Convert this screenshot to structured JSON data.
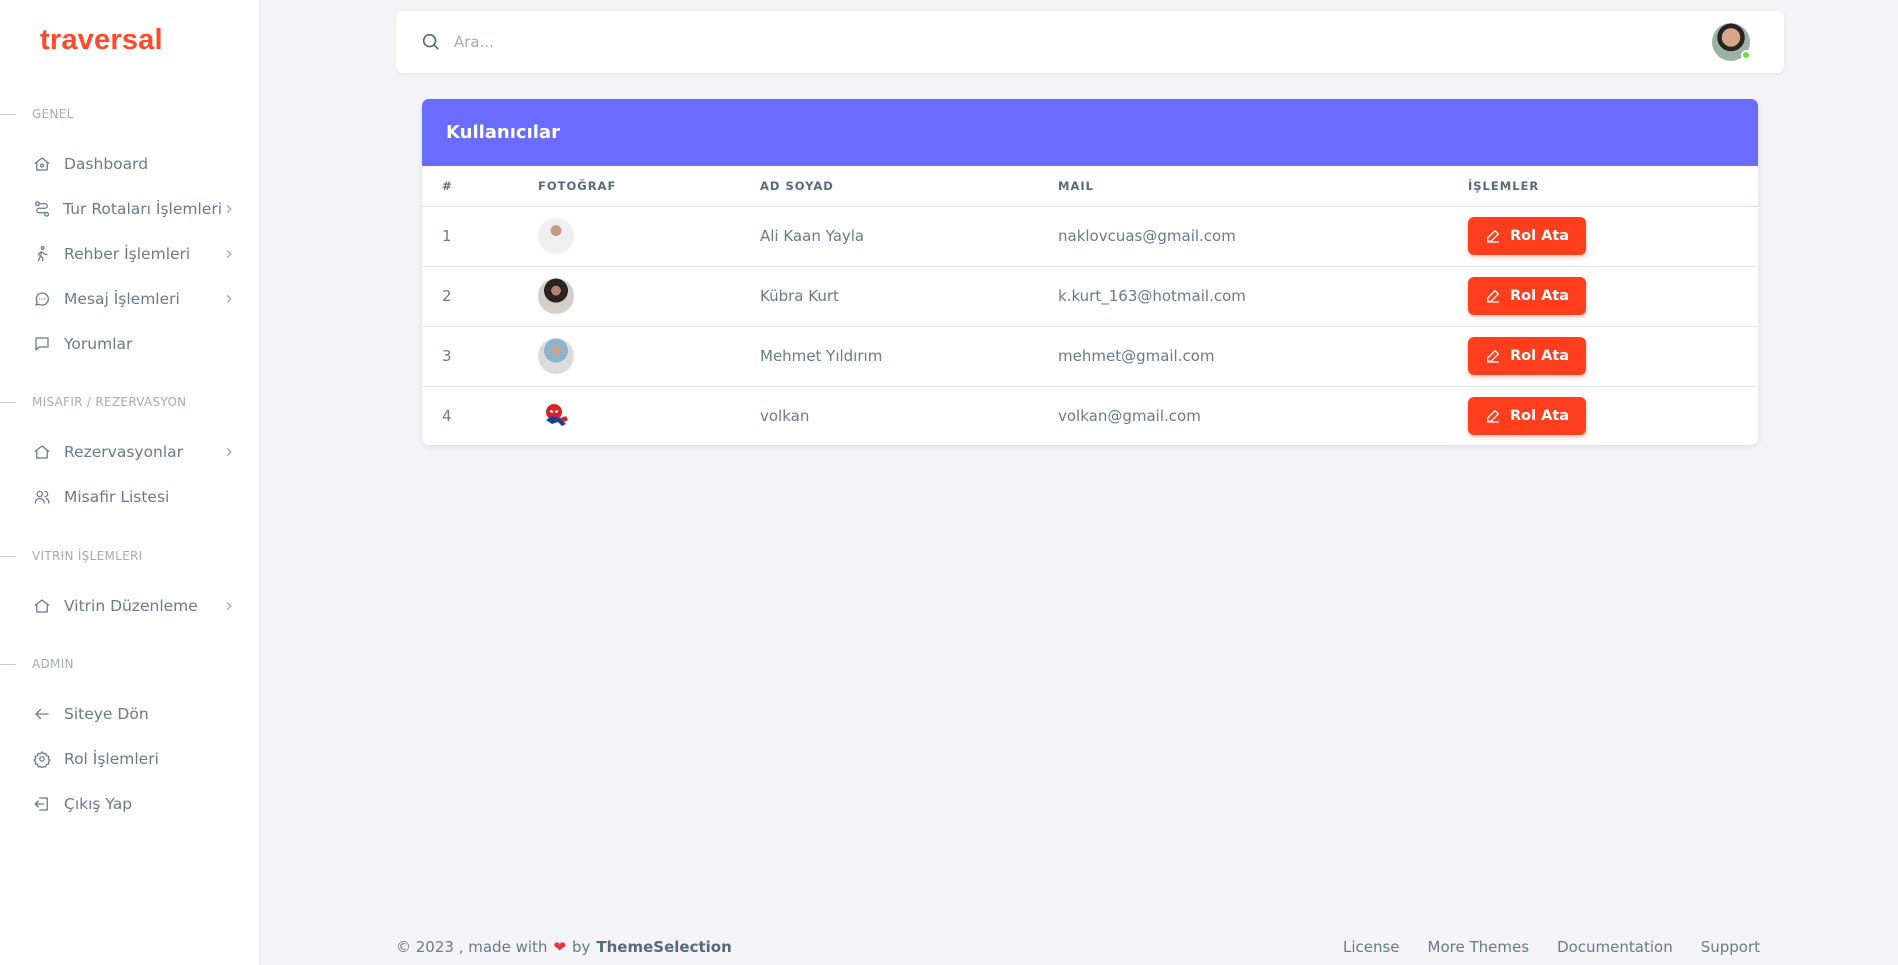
{
  "brand": "traversal",
  "sidebar": {
    "sections": [
      {
        "title": "GENEL"
      },
      {
        "title": "MISAFIR / REZERVASYON"
      },
      {
        "title": "VITRIN İŞLEMLERI"
      },
      {
        "title": "ADMIN"
      }
    ],
    "items": [
      {
        "label": "Dashboard",
        "icon": "home-icon",
        "has_submenu": false
      },
      {
        "label": "Tur Rotaları İşlemleri",
        "icon": "route-icon",
        "has_submenu": true
      },
      {
        "label": "Rehber İşlemleri",
        "icon": "walk-icon",
        "has_submenu": true
      },
      {
        "label": "Mesaj İşlemleri",
        "icon": "chat-icon",
        "has_submenu": true
      },
      {
        "label": "Yorumlar",
        "icon": "comment-icon",
        "has_submenu": false
      },
      {
        "label": "Rezervasyonlar",
        "icon": "home-icon",
        "has_submenu": true
      },
      {
        "label": "Misafir Listesi",
        "icon": "users-icon",
        "has_submenu": false
      },
      {
        "label": "Vitrin Düzenleme",
        "icon": "home-icon",
        "has_submenu": true
      },
      {
        "label": "Siteye Dön",
        "icon": "arrow-left-icon",
        "has_submenu": false
      },
      {
        "label": "Rol İşlemleri",
        "icon": "gear-icon",
        "has_submenu": false
      },
      {
        "label": "Çıkış Yap",
        "icon": "logout-icon",
        "has_submenu": false
      }
    ]
  },
  "navbar": {
    "search_placeholder": "Ara...",
    "status": "online"
  },
  "card": {
    "title": "Kullanıcılar",
    "columns": [
      "#",
      "FOTOĞRAF",
      "AD SOYAD",
      "MAIL",
      "İŞLEMLER"
    ],
    "rows": [
      {
        "id": "1",
        "name": "Ali Kaan Yayla",
        "mail": "naklovcuas@gmail.com",
        "action": "Rol Ata"
      },
      {
        "id": "2",
        "name": "Kübra Kurt",
        "mail": "k.kurt_163@hotmail.com",
        "action": "Rol Ata"
      },
      {
        "id": "3",
        "name": "Mehmet Yıldırım",
        "mail": "mehmet@gmail.com",
        "action": "Rol Ata"
      },
      {
        "id": "4",
        "name": "volkan",
        "mail": "volkan@gmail.com",
        "action": "Rol Ata"
      }
    ]
  },
  "footer": {
    "copyright": "© 2023 , made with",
    "by": "by",
    "brand": "ThemeSelection",
    "links": [
      "License",
      "More Themes",
      "Documentation",
      "Support"
    ]
  },
  "colors": {
    "brand": "#ff4a2a",
    "card_header": "#696cff",
    "button": "#ff3e1d",
    "online": "#71dd37",
    "heart": "#e8373e"
  }
}
